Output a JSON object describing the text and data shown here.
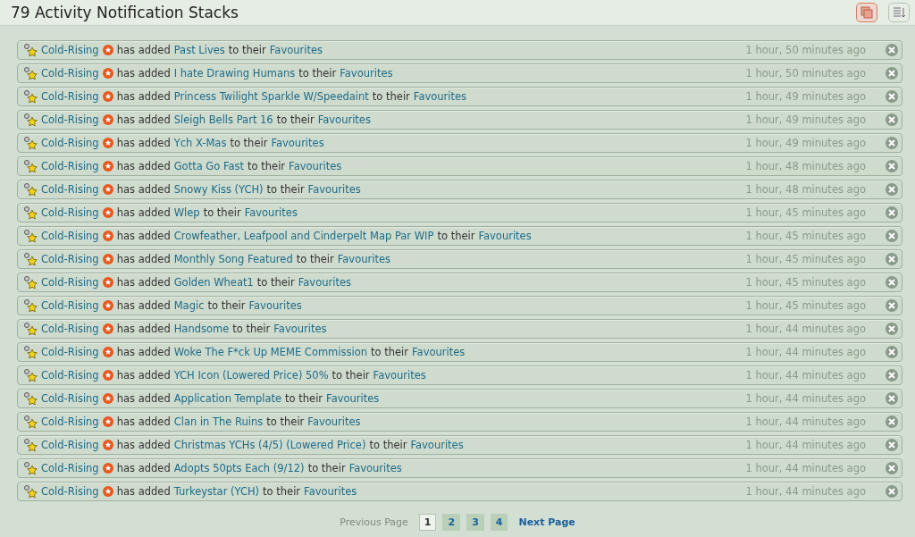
{
  "header": {
    "title": "79 Activity Notification Stacks",
    "view_buttons": [
      {
        "kind": "stack",
        "selected": true
      },
      {
        "kind": "list",
        "selected": false
      }
    ]
  },
  "notifications": [
    {
      "user": "Cold-Rising",
      "action": "has added",
      "item": "Past Lives",
      "connector": "to their",
      "target": "Favourites",
      "time": "1 hour, 50 minutes ago"
    },
    {
      "user": "Cold-Rising",
      "action": "has added",
      "item": "I hate Drawing Humans",
      "connector": "to their",
      "target": "Favourites",
      "time": "1 hour, 50 minutes ago"
    },
    {
      "user": "Cold-Rising",
      "action": "has added",
      "item": "Princess Twilight Sparkle W/Speedaint",
      "connector": "to their",
      "target": "Favourites",
      "time": "1 hour, 49 minutes ago"
    },
    {
      "user": "Cold-Rising",
      "action": "has added",
      "item": "Sleigh Bells Part 16",
      "connector": "to their",
      "target": "Favourites",
      "time": "1 hour, 49 minutes ago"
    },
    {
      "user": "Cold-Rising",
      "action": "has added",
      "item": "Ych X-Mas",
      "connector": "to their",
      "target": "Favourites",
      "time": "1 hour, 49 minutes ago"
    },
    {
      "user": "Cold-Rising",
      "action": "has added",
      "item": "Gotta Go Fast",
      "connector": "to their",
      "target": "Favourites",
      "time": "1 hour, 48 minutes ago"
    },
    {
      "user": "Cold-Rising",
      "action": "has added",
      "item": "Snowy Kiss (YCH)",
      "connector": "to their",
      "target": "Favourites",
      "time": "1 hour, 48 minutes ago"
    },
    {
      "user": "Cold-Rising",
      "action": "has added",
      "item": "Wlep",
      "connector": "to their",
      "target": "Favourites",
      "time": "1 hour, 45 minutes ago"
    },
    {
      "user": "Cold-Rising",
      "action": "has added",
      "item": "Crowfeather, Leafpool and Cinderpelt Map Par WIP",
      "connector": "to their",
      "target": "Favourites",
      "time": "1 hour, 45 minutes ago"
    },
    {
      "user": "Cold-Rising",
      "action": "has added",
      "item": "Monthly Song Featured",
      "connector": "to their",
      "target": "Favourites",
      "time": "1 hour, 45 minutes ago"
    },
    {
      "user": "Cold-Rising",
      "action": "has added",
      "item": "Golden Wheat1",
      "connector": "to their",
      "target": "Favourites",
      "time": "1 hour, 45 minutes ago"
    },
    {
      "user": "Cold-Rising",
      "action": "has added",
      "item": "Magic",
      "connector": "to their",
      "target": "Favourites",
      "time": "1 hour, 45 minutes ago"
    },
    {
      "user": "Cold-Rising",
      "action": "has added",
      "item": "Handsome",
      "connector": "to their",
      "target": "Favourites",
      "time": "1 hour, 44 minutes ago"
    },
    {
      "user": "Cold-Rising",
      "action": "has added",
      "item": "Woke The F*ck Up MEME Commission",
      "connector": "to their",
      "target": "Favourites",
      "time": "1 hour, 44 minutes ago"
    },
    {
      "user": "Cold-Rising",
      "action": "has added",
      "item": "YCH Icon (Lowered Price) 50%",
      "connector": "to their",
      "target": "Favourites",
      "time": "1 hour, 44 minutes ago"
    },
    {
      "user": "Cold-Rising",
      "action": "has added",
      "item": "Application Template",
      "connector": "to their",
      "target": "Favourites",
      "time": "1 hour, 44 minutes ago"
    },
    {
      "user": "Cold-Rising",
      "action": "has added",
      "item": "Clan in The Ruins",
      "connector": "to their",
      "target": "Favourites",
      "time": "1 hour, 44 minutes ago"
    },
    {
      "user": "Cold-Rising",
      "action": "has added",
      "item": "Christmas YCHs (4/5) (Lowered Price)",
      "connector": "to their",
      "target": "Favourites",
      "time": "1 hour, 44 minutes ago"
    },
    {
      "user": "Cold-Rising",
      "action": "has added",
      "item": "Adopts 50pts Each (9/12)",
      "connector": "to their",
      "target": "Favourites",
      "time": "1 hour, 44 minutes ago"
    },
    {
      "user": "Cold-Rising",
      "action": "has added",
      "item": "Turkeystar (YCH)",
      "connector": "to their",
      "target": "Favourites",
      "time": "1 hour, 44 minutes ago"
    }
  ],
  "pagination": {
    "previous": {
      "label": "Previous Page",
      "disabled": true
    },
    "pages": [
      {
        "label": "1",
        "selected": true
      },
      {
        "label": "2",
        "selected": false
      },
      {
        "label": "3",
        "selected": false
      },
      {
        "label": "4",
        "selected": false
      }
    ],
    "next": {
      "label": "Next Page",
      "disabled": false
    }
  }
}
